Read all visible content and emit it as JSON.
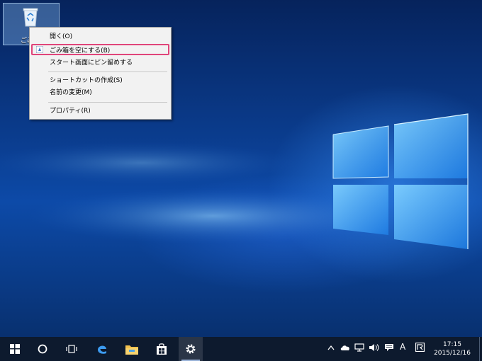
{
  "desktop": {
    "recycle_bin_label": "ごみ"
  },
  "context_menu": {
    "items": [
      {
        "label": "開く(O)"
      },
      {
        "label": "ごみ箱を空にする(B)"
      },
      {
        "label": "スタート画面にピン留めする"
      },
      {
        "label": "ショートカットの作成(S)"
      },
      {
        "label": "名前の変更(M)"
      },
      {
        "label": "プロパティ(R)"
      }
    ],
    "highlight_color": "#e0457a"
  },
  "taskbar": {
    "pinned": [
      {
        "icon": "windows-start-icon"
      },
      {
        "icon": "cortana-search-icon"
      },
      {
        "icon": "task-view-icon"
      },
      {
        "icon": "edge-browser-icon"
      },
      {
        "icon": "file-explorer-icon"
      },
      {
        "icon": "store-icon"
      },
      {
        "icon": "settings-gear-icon",
        "active": true
      }
    ],
    "tray": {
      "ime_label": "A"
    },
    "clock": {
      "time": "17:15",
      "date": "2015/12/16"
    }
  }
}
